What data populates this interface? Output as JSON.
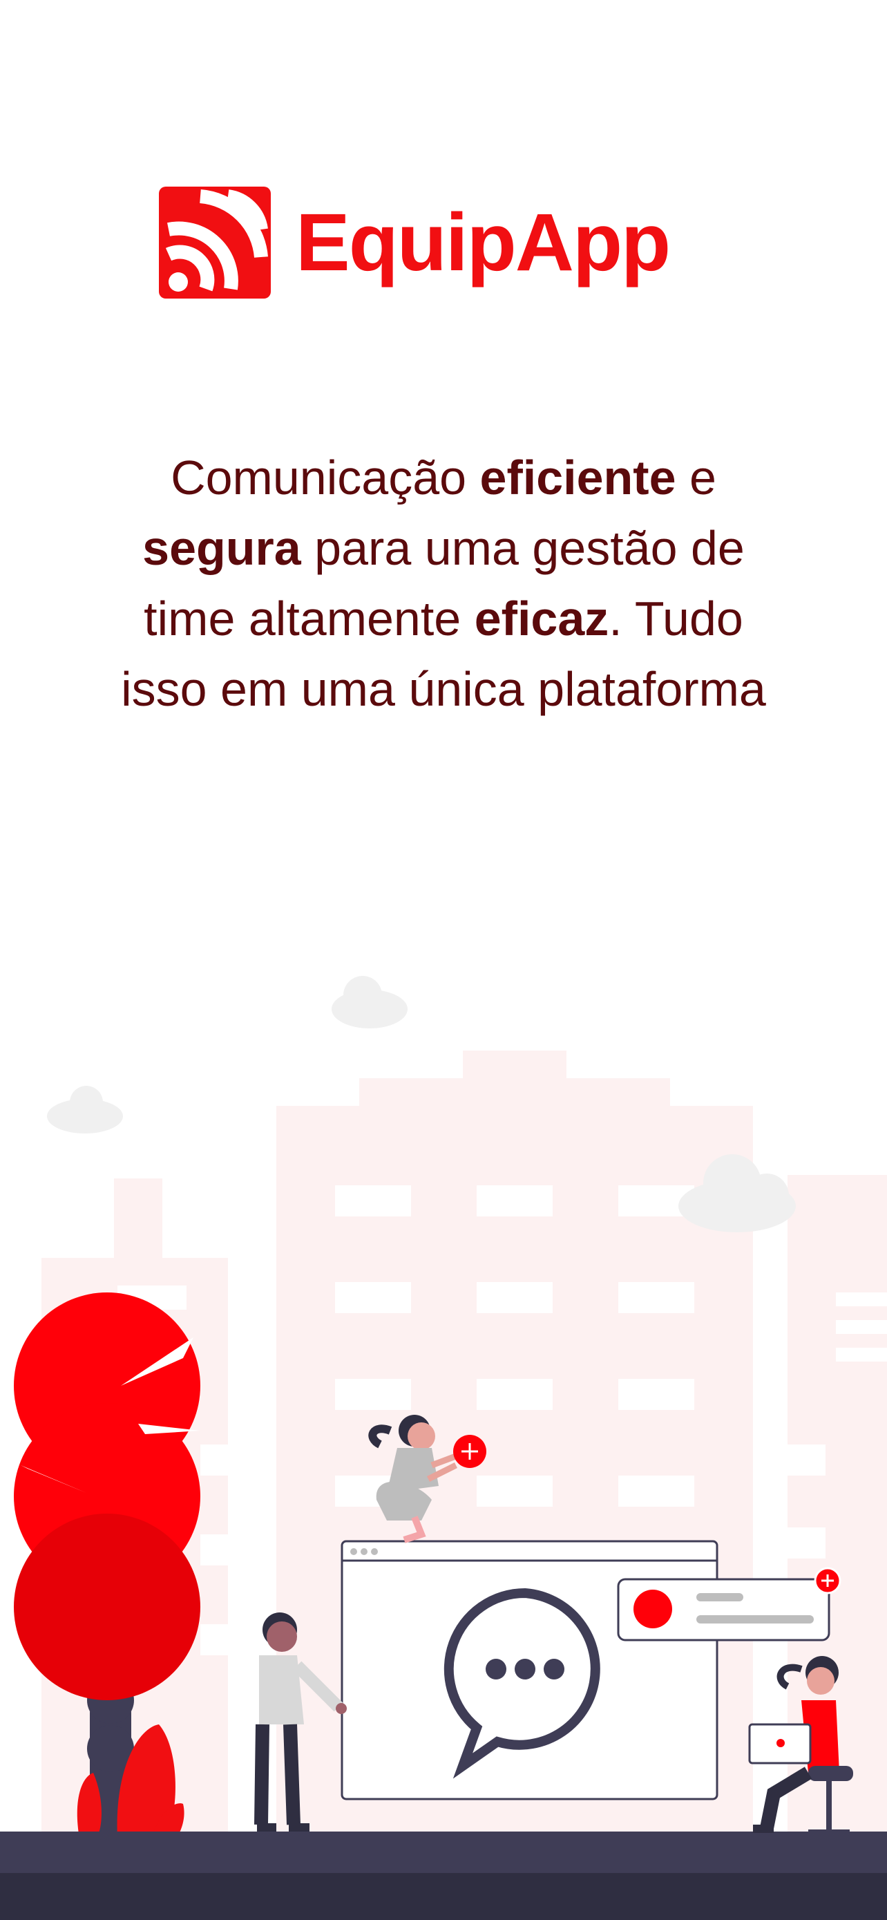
{
  "brand": {
    "name": "EquipApp",
    "logo_icon": "broadcast-signal-icon",
    "color": "#f10f12"
  },
  "tagline": {
    "p1": "Comunicação ",
    "b1": "eficiente",
    "p2": " e",
    "b2": "segura",
    "p3": " para uma gestão de",
    "p4": "time altamente ",
    "b3": "eficaz",
    "p5": ". Tudo",
    "p6": "isso em uma única plataforma",
    "color": "#5b0a0c"
  },
  "illustration": {
    "description_icon": "team-chat-illustration",
    "accent": "#f10f12",
    "ground": "#3f3d56"
  }
}
